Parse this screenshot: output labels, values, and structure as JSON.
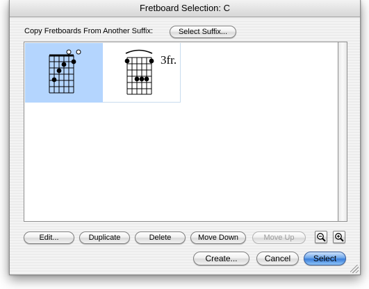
{
  "window": {
    "title": "Fretboard Selection: C"
  },
  "copy_row": {
    "label": "Copy Fretboards From Another Suffix:",
    "select_suffix_button": "Select Suffix..."
  },
  "fretboards": [
    {
      "id": "open-c",
      "selected": true,
      "fret_label": ""
    },
    {
      "id": "barre-c",
      "selected": false,
      "fret_label": "3fr."
    }
  ],
  "edit_buttons": {
    "edit": "Edit...",
    "duplicate": "Duplicate",
    "delete": "Delete",
    "move_down": "Move Down",
    "move_up": "Move Up"
  },
  "zoom": {
    "zoom_out_icon": "zoom-out-magnifier",
    "zoom_in_icon": "zoom-in-magnifier"
  },
  "dialog_buttons": {
    "create": "Create...",
    "cancel": "Cancel",
    "select": "Select"
  },
  "colors": {
    "selection": "#b4d5fe",
    "default_button": "#3b7fdb"
  }
}
